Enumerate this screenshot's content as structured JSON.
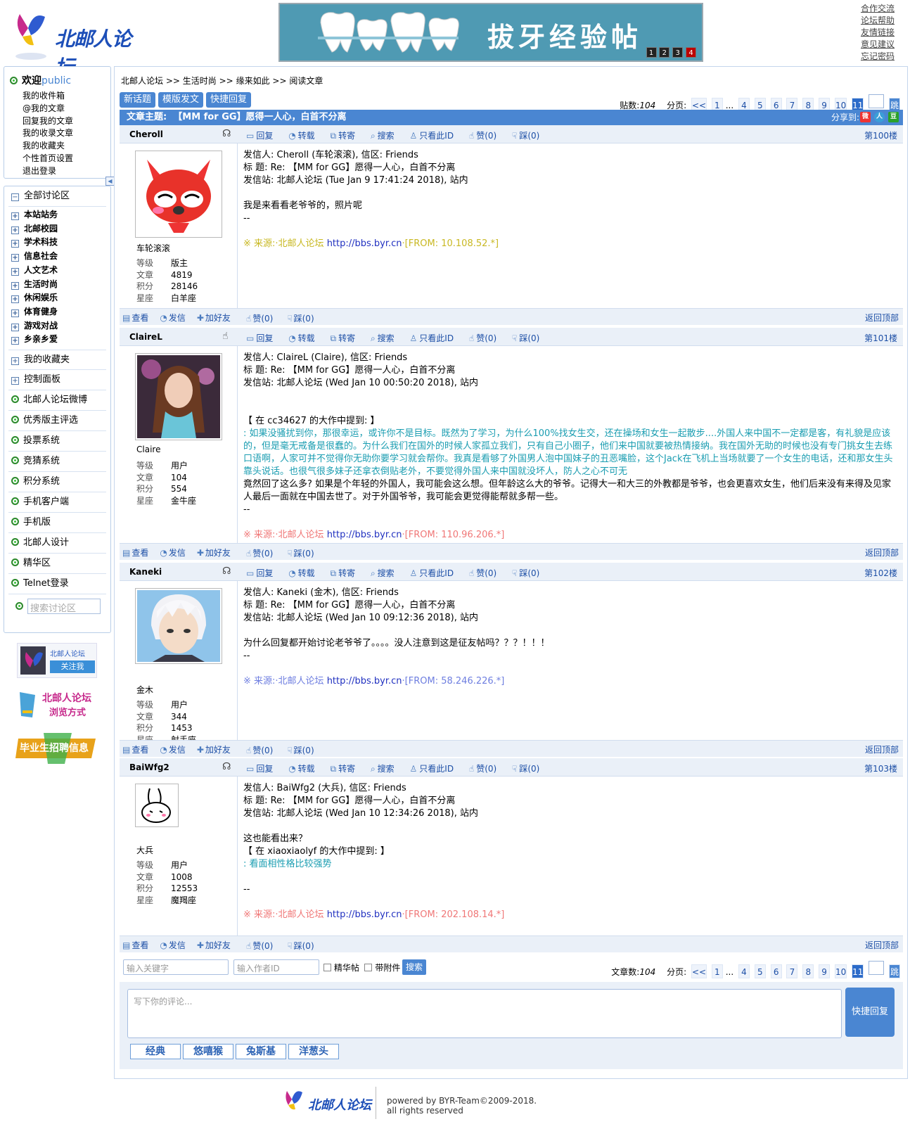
{
  "header": {
    "logo_text": "北邮人论坛",
    "banner_text": "拔牙经验帖",
    "banner_pages": [
      "1",
      "2",
      "3",
      "4"
    ],
    "top_links": [
      "合作交流",
      "论坛帮助",
      "友情链接",
      "意见建议",
      "忘记密码"
    ]
  },
  "sidebar": {
    "welcome": "欢迎",
    "user": "public",
    "user_links": [
      "我的收件箱",
      "@我的文章",
      "回复我的文章",
      "我的收录文章",
      "我的收藏夹",
      "个性首页设置",
      "退出登录"
    ],
    "all_boards": "全部讨论区",
    "boards": [
      "本站站务",
      "北邮校园",
      "学术科技",
      "信息社会",
      "人文艺术",
      "生活时尚",
      "休闲娱乐",
      "体育健身",
      "游戏对战",
      "乡亲乡爱"
    ],
    "expand_items": [
      "我的收藏夹",
      "控制面板"
    ],
    "dot_items": [
      "北邮人论坛微博",
      "优秀版主评选",
      "投票系统",
      "竞猜系统",
      "积分系统",
      "手机客户端",
      "手机版",
      "北邮人设计",
      "精华区",
      "Telnet登录"
    ],
    "search_placeholder": "搜索讨论区",
    "ad_follow_title": "北邮人论坛",
    "ad_follow_btn": "关注我",
    "ad_browse_1": "北邮人论坛",
    "ad_browse_2": "浏览方式",
    "ad_jobs": "毕业生招聘信息"
  },
  "breadcrumb": [
    "北邮人论坛",
    ">>",
    "生活时尚",
    ">>",
    "缘来如此",
    ">>",
    "阅读文章"
  ],
  "toolbar": {
    "buttons": [
      "新话题",
      "模版发文",
      "快捷回复"
    ],
    "post_count_label": "贴数:",
    "post_count": "104",
    "pages_label": "分页:",
    "pages": [
      "<<",
      "1",
      "...",
      "4",
      "5",
      "6",
      "7",
      "8",
      "9",
      "10",
      "11"
    ],
    "current_page": "11",
    "jump": "跳"
  },
  "title_bar": {
    "label": "文章主题:",
    "title": "【MM for GG】愿得一人心，白首不分离",
    "share_label": "分享到:"
  },
  "post_tools": [
    "回复",
    "转载",
    "转寄",
    "搜索",
    "只看此ID",
    "赞(0)",
    "踩(0)"
  ],
  "post_foot_left": [
    "查看",
    "发信",
    "加好友"
  ],
  "post_foot_mid": [
    "赞(0)",
    "踩(0)"
  ],
  "back_top": "返回顶部",
  "user_info_keys": [
    "等级",
    "文章",
    "积分",
    "星座"
  ],
  "posts": [
    {
      "id": "Cheroll",
      "floor": "第100楼",
      "nick": "车轮滚滚",
      "level": "版主",
      "articles": "4819",
      "score": "28146",
      "sign": "白羊座",
      "lines": [
        "发信人: Cheroll (车轮滚滚), 信区: Friends",
        "标  题: Re: 【MM for GG】愿得一人心，白首不分离",
        "发信站: 北邮人论坛 (Tue Jan  9 17:41:24 2018), 站内",
        "",
        "我是来看看老爷爷的，照片呢",
        "--"
      ],
      "src": "※ 来源:·北邮人论坛",
      "url": "http://bbs.byr.cn",
      "from": "·[FROM: 10.108.52.*]"
    },
    {
      "id": "ClaireL",
      "floor": "第101楼",
      "nick": "Claire",
      "level": "用户",
      "articles": "104",
      "score": "554",
      "sign": "金牛座",
      "lines": [
        "发信人: ClaireL (Claire), 信区: Friends",
        "标  题: Re: 【MM for GG】愿得一人心，白首不分离",
        "发信站: 北邮人论坛 (Wed Jan 10 00:50:20 2018), 站内"
      ],
      "quote_head": "【 在 cc34627 的大作中提到: 】",
      "quote": ": 如果没骚扰到你，那很幸运，或许你不是目标。既然为了学习，为什么100%找女生交，还在操场和女生一起散步....外国人来中国不一定都是客，有礼貌是应该的，但是毫无戒备是很蠢的。为什么我们在国外的时候人家孤立我们，只有自己小圈子，他们来中国就要被热情接纳。我在国外无助的时候也没有专门挑女生去练口语啊，人家可并不觉得你无助你要学习就会帮你。我真是看够了外国男人泡中国妹子的丑恶嘴脸，这个Jack在飞机上当场就要了一个女生的电话，还和那女生头靠头说话。也很气很多妹子还拿衣倒贴老外，不要觉得外国人来中国就没坏人，防人之心不可无",
      "reply": "竟然回了这么多? 如果是个年轻的外国人，我可能会这么想。但年龄这么大的爷爷。记得大一和大三的外教都是爷爷，也会更喜欢女生，他们后来没有来得及见家人最后一面就在中国去世了。对于外国爷爷，我可能会更觉得能帮就多帮一些。",
      "tail": "--",
      "src": "※ 来源:·北邮人论坛",
      "url": "http://bbs.byr.cn",
      "from": "·[FROM: 110.96.206.*]"
    },
    {
      "id": "Kaneki",
      "floor": "第102楼",
      "nick": "金木",
      "level": "用户",
      "articles": "344",
      "score": "1453",
      "sign": "射手座",
      "lines": [
        "发信人: Kaneki (金木), 信区: Friends",
        "标  题: Re: 【MM for GG】愿得一人心，白首不分离",
        "发信站: 北邮人论坛 (Wed Jan 10 09:12:36 2018), 站内",
        "",
        "为什么回复都开始讨论老爷爷了。。。。没人注意到这是征友帖吗？？？！！！",
        "--"
      ],
      "src": "※ 来源:·北邮人论坛",
      "url": "http://bbs.byr.cn",
      "from": "·[FROM: 58.246.226.*]"
    },
    {
      "id": "BaiWfg2",
      "floor": "第103楼",
      "nick": "大兵",
      "level": "用户",
      "articles": "1008",
      "score": "12553",
      "sign": "魔羯座",
      "lines": [
        "发信人: BaiWfg2 (大兵), 信区: Friends",
        "标  题: Re: 【MM for GG】愿得一人心，白首不分离",
        "发信站: 北邮人论坛 (Wed Jan 10 12:34:26 2018), 站内",
        "",
        "这也能看出来？"
      ],
      "quote_head": "【 在 xiaoxiaolyf 的大作中提到: 】",
      "quote": ": 看面相性格比较强势",
      "tail": "--",
      "src": "※ 来源:·北邮人论坛",
      "url": "http://bbs.byr.cn",
      "from": "·[FROM: 202.108.14.*]"
    }
  ],
  "bottom": {
    "keyword_placeholder": "输入关键字",
    "author_placeholder": "输入作者ID",
    "check_digest": "精华帖",
    "check_attach": "带附件",
    "search_btn": "搜索",
    "article_count_label": "文章数:",
    "article_count": "104",
    "pages_label": "分页:",
    "reply_placeholder": "写下你的评论...",
    "quick_reply": "快捷回复",
    "emoticons": [
      "经典",
      "悠嘻猴",
      "兔斯基",
      "洋葱头"
    ]
  },
  "footer": {
    "logo_text": "北邮人论坛",
    "powered": "powered by BYR-Team©2009-2018.",
    "rights": "all rights reserved"
  }
}
